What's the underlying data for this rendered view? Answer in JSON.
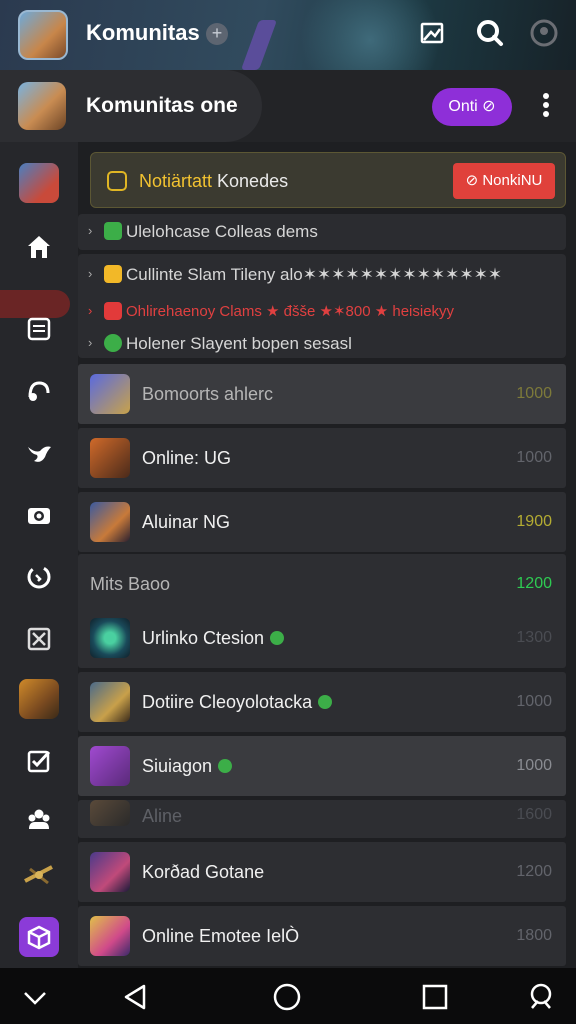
{
  "topbar": {
    "title": "Komunitas",
    "add_symbol": "+"
  },
  "header": {
    "title": "Komunitas one",
    "online_button": "Onti ⊘"
  },
  "notice": {
    "highlight": "Notiärtatt",
    "text": " Konedes",
    "button": "⊘ NonkiNU",
    "colors": {
      "accent": "#f2c230",
      "button": "#e0413b"
    }
  },
  "categories": [
    {
      "label": "Ulelohcase Colleas dems",
      "color": "#3cae48"
    },
    {
      "label": "Cullinte Slam Tileny alo✶✶✶✶✶✶✶✶✶✶✶✶✶✶",
      "color": "#f2b828"
    },
    {
      "label": "Ohlirehaenoy Clams ★ đšše ★✶800 ★ heisiekyy",
      "color": "#e23a3a"
    },
    {
      "label": "Holener Slayent bopen sesasl",
      "color": "#3cae48"
    }
  ],
  "rows": [
    {
      "name": "Bomoorts ahlerc",
      "count": "1000",
      "badge": false,
      "dim": true,
      "count_color": "#7d7a3a"
    },
    {
      "name": "Online: UG",
      "count": "1000",
      "badge": false,
      "dim": false,
      "count_color": "#62646b"
    },
    {
      "name": "Aluinar NG",
      "count": "1900",
      "badge": false,
      "dim": false,
      "count_color": "#b4ac32"
    },
    {
      "name": "Mits  Baoo",
      "count": "1200",
      "badge": false,
      "dim": true,
      "count_color": "#2ecb52"
    },
    {
      "name": "Urlinko Ctesion",
      "count": "1300",
      "badge": true,
      "dim": false,
      "count_color": "#4a4c52"
    },
    {
      "name": "Dotiire Cleoyolotacka",
      "count": "1000",
      "badge": true,
      "dim": false,
      "count_color": "#62646b"
    },
    {
      "name": "Siuiagon",
      "count": "1000",
      "badge": true,
      "dim": false,
      "count_color": "#8a8c92"
    },
    {
      "name": "Aline",
      "count": "1600",
      "badge": false,
      "dim": true,
      "count_color": "#4a4c52"
    },
    {
      "name": "Korðad Gotane",
      "count": "1200",
      "badge": false,
      "dim": false,
      "count_color": "#62646b"
    },
    {
      "name": "Online Emotee IelÒ",
      "count": "1800",
      "badge": false,
      "dim": false,
      "count_color": "#62646b"
    }
  ]
}
